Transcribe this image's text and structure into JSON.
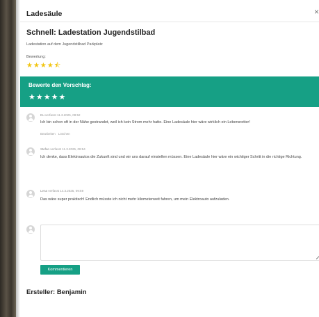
{
  "modal": {
    "title": "Ladesäule",
    "close_icon": "×"
  },
  "suggestion": {
    "heading": "Schnell: Ladestation Jugendstilbad",
    "description": "Ladestation auf dem Jugendstilbad Parkplatz",
    "rating_label": "Bewertung:",
    "rating_value": 4.5,
    "rating_stars": "★★★★⯪"
  },
  "rate": {
    "label": "Bewerte den Vorschlag:",
    "stars": "★★★★★"
  },
  "comments": [
    {
      "author": "Du",
      "meta": "verfasst 11.3.2025, 08:52",
      "text": "Ich bin schon oft in der Nähe gestrandet, weil ich kein Strom mehr hatte. Eine Ladesäule hier wäre wirklich ein Lebensretter!",
      "edit_label": "Bearbeiten",
      "delete_label": "Löschen"
    },
    {
      "author": "Stefan",
      "meta": "verfasst 11.3.2025, 08:54",
      "text": "Ich denke, dass Elektroautos die Zukunft sind und wir uns darauf einstellen müssen. Eine Ladesäule hier wäre ein wichtiger Schritt in die richtige Richtung."
    },
    {
      "author": "Lena",
      "meta": "verfasst 14.3.2025, 09:59",
      "text": "Das wäre super praktisch! Endlich müsste ich nicht mehr kilometerweit fahren, um mein Elektroauto aufzuladen."
    }
  ],
  "comment_form": {
    "placeholder": "",
    "submit_label": "Kommentieren"
  },
  "creator": "Ersteller: Benjamin",
  "colors": {
    "accent": "#16a085",
    "star": "#f1c40f"
  }
}
